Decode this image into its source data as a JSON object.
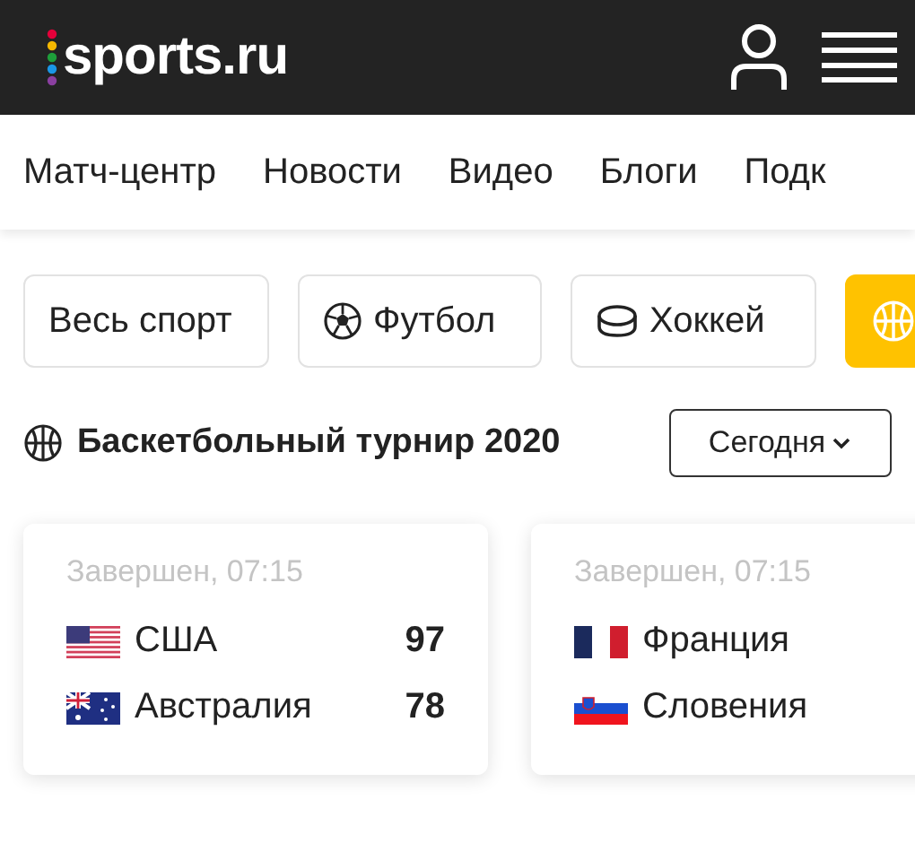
{
  "header": {
    "logo": "sports.ru"
  },
  "nav": [
    {
      "label": "Матч-центр"
    },
    {
      "label": "Новости"
    },
    {
      "label": "Видео"
    },
    {
      "label": "Блоги"
    },
    {
      "label": "Подк"
    }
  ],
  "chips": [
    {
      "label": "Весь спорт",
      "selected": false
    },
    {
      "label": "Футбол",
      "selected": false
    },
    {
      "label": "Хоккей",
      "selected": false
    },
    {
      "selected": true
    }
  ],
  "tournament": {
    "title": "Баскетбольный турнир 2020",
    "date_select": "Сегодня"
  },
  "matches": [
    {
      "status": "Завершен, 07:15",
      "teams": [
        {
          "name": "США",
          "score": "97"
        },
        {
          "name": "Австралия",
          "score": "78"
        }
      ]
    },
    {
      "status": "Завершен, 07:15",
      "teams": [
        {
          "name": "Франция"
        },
        {
          "name": "Словения"
        }
      ]
    }
  ]
}
